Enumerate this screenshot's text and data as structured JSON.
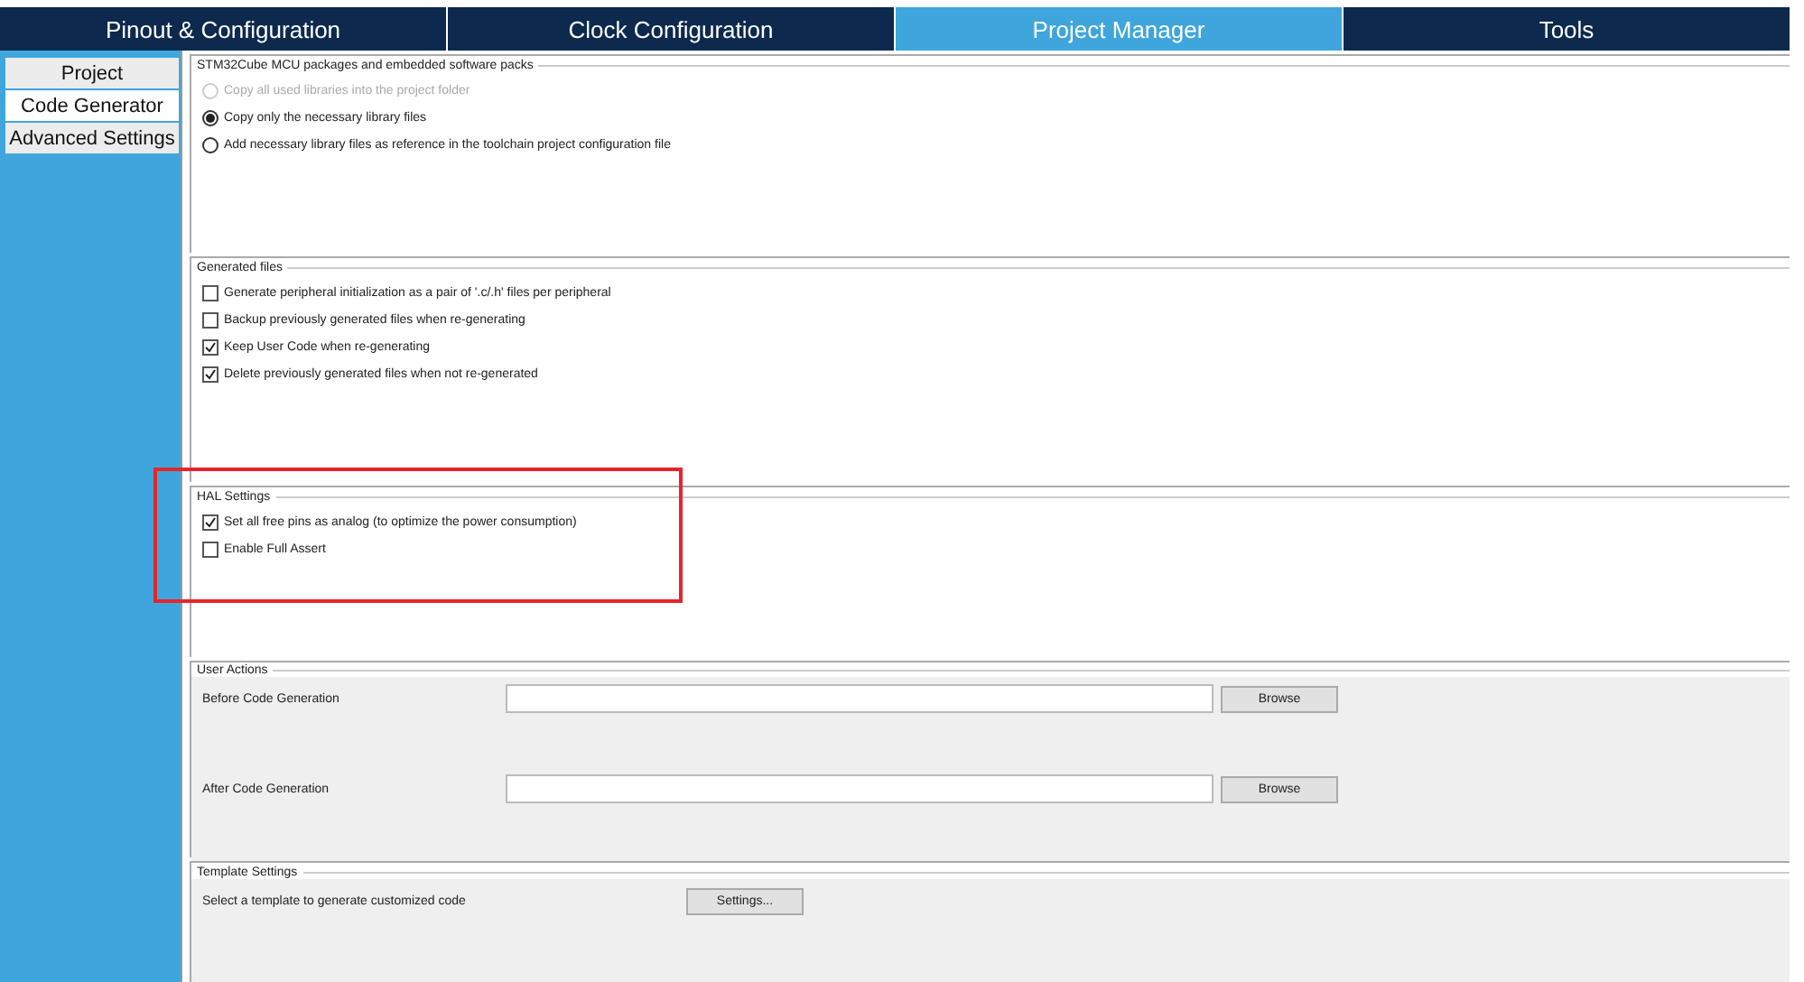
{
  "tabs": [
    {
      "label": "Pinout & Configuration",
      "selected": false
    },
    {
      "label": "Clock Configuration",
      "selected": false
    },
    {
      "label": "Project Manager",
      "selected": true
    },
    {
      "label": "Tools",
      "selected": false
    }
  ],
  "sidebar": {
    "items": [
      {
        "label": "Project",
        "selected": false
      },
      {
        "label": "Code Generator",
        "selected": true
      },
      {
        "label": "Advanced Settings",
        "selected": false
      }
    ]
  },
  "sections": [
    {
      "kind": "radios",
      "title": "STM32Cube MCU packages and embedded software packs",
      "highlighted": false,
      "items": [
        {
          "label": "Copy all used libraries into the project folder",
          "selected": false,
          "disabled": true
        },
        {
          "label": "Copy only the necessary library files",
          "selected": true,
          "disabled": false
        },
        {
          "label": "Add necessary library files as reference in the toolchain project configuration file",
          "selected": false,
          "disabled": false
        }
      ]
    },
    {
      "kind": "checkboxes",
      "title": "Generated files",
      "highlighted": false,
      "items": [
        {
          "label": "Generate peripheral initialization as a pair of '.c/.h' files per peripheral",
          "checked": false
        },
        {
          "label": "Backup previously generated files when re-generating",
          "checked": false
        },
        {
          "label": "Keep User Code when re-generating",
          "checked": true
        },
        {
          "label": "Delete previously generated files when not re-generated",
          "checked": true
        }
      ]
    },
    {
      "kind": "checkboxes",
      "title": "HAL Settings",
      "highlighted": true,
      "items": [
        {
          "label": "Set all free pins as analog (to optimize the power consumption)",
          "checked": true
        },
        {
          "label": "Enable Full Assert",
          "checked": false
        }
      ]
    },
    {
      "kind": "actions",
      "title": "User Actions",
      "highlighted": false,
      "rows": [
        {
          "label": "Before Code Generation",
          "button": "Browse"
        },
        {
          "label": "After Code Generation",
          "button": "Browse"
        }
      ]
    },
    {
      "kind": "template",
      "title": "Template Settings",
      "highlighted": false,
      "label": "Select a template to generate customized code",
      "button": "Settings..."
    }
  ]
}
